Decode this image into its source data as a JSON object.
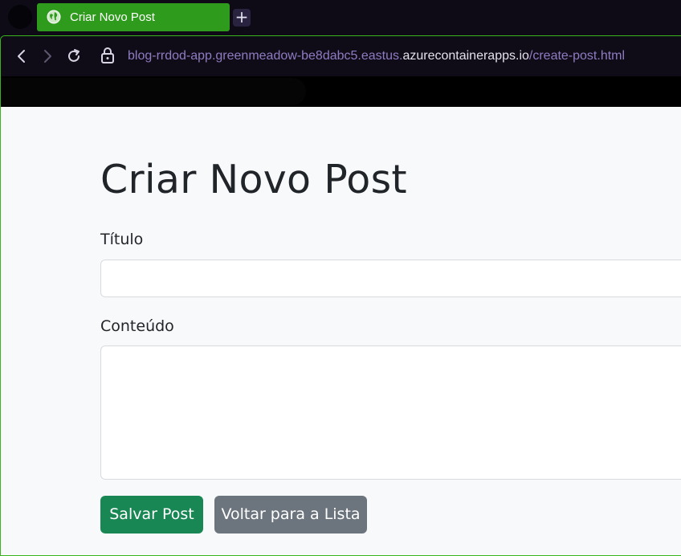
{
  "browser": {
    "tab_title": "Criar Novo Post",
    "new_tab_symbol": "+",
    "url_prefix": "blog-rrdod-app.greenmeadow-be8dabc5.eastus.",
    "url_domain": "azurecontainerapps.io",
    "url_path": "/create-post.html",
    "icons": [
      "globe-icon",
      "back-arrow-icon",
      "forward-arrow-icon",
      "reload-icon",
      "lock-icon"
    ]
  },
  "page": {
    "title": "Criar Novo Post",
    "form": {
      "title_label": "Título",
      "title_value": "",
      "content_label": "Conteúdo",
      "content_value": ""
    },
    "buttons": {
      "save": "Salvar Post",
      "back": "Voltar para a Lista"
    }
  },
  "colors": {
    "tab_active": "#2f9b1c",
    "save_button": "#198754",
    "back_button": "#6c757d",
    "page_background": "#f8f9fa"
  }
}
